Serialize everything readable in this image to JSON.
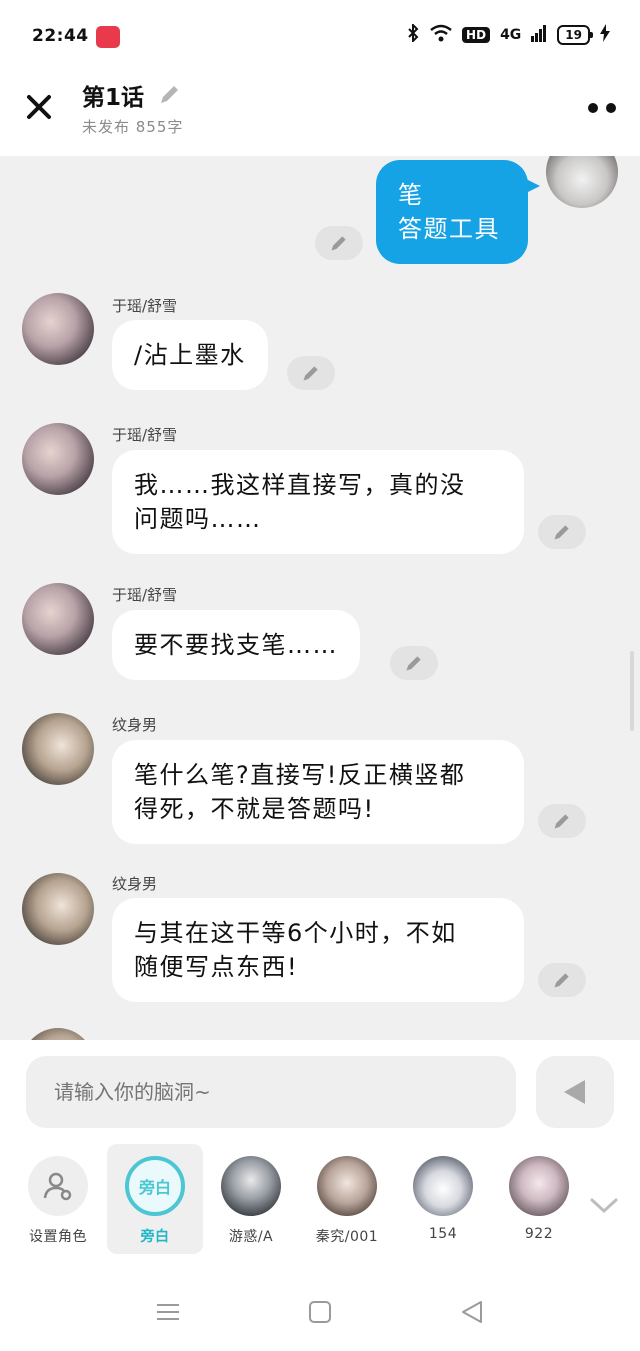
{
  "status_bar": {
    "time": "22:44",
    "hd": "HD",
    "network": "4G",
    "battery": "19"
  },
  "header": {
    "title": "第1话",
    "subtitle": "未发布 855字"
  },
  "messages": [
    {
      "speaker": "",
      "text_lines": [
        "笔",
        "答题工具"
      ],
      "self": true
    },
    {
      "speaker": "于瑶/舒雪",
      "text_lines": [
        "/沾上墨水"
      ]
    },
    {
      "speaker": "于瑶/舒雪",
      "text_lines": [
        "我……我这样直接写，真的没",
        "问题吗……"
      ]
    },
    {
      "speaker": "于瑶/舒雪",
      "text_lines": [
        "要不要找支笔……"
      ]
    },
    {
      "speaker": "纹身男",
      "text_lines": [
        "笔什么笔?直接写!反正横竖都",
        "得死，不就是答题吗!"
      ]
    },
    {
      "speaker": "纹身男",
      "text_lines": [
        "与其在这干等6个小时，不如",
        "随便写点东西!"
      ]
    }
  ],
  "input": {
    "placeholder": "请输入你的脑洞~"
  },
  "roles": [
    {
      "label": "设置角色",
      "icon": "person-settings-icon"
    },
    {
      "label": "旁白",
      "circle_text": "旁白",
      "selected": true
    },
    {
      "label": "游惑/A"
    },
    {
      "label": "秦究/001"
    },
    {
      "label": "154"
    },
    {
      "label": "922"
    }
  ],
  "colors": {
    "accent_blue": "#16a3e6",
    "narrator_teal": "#4cc6d3",
    "chat_bg": "#f0f0f0"
  }
}
